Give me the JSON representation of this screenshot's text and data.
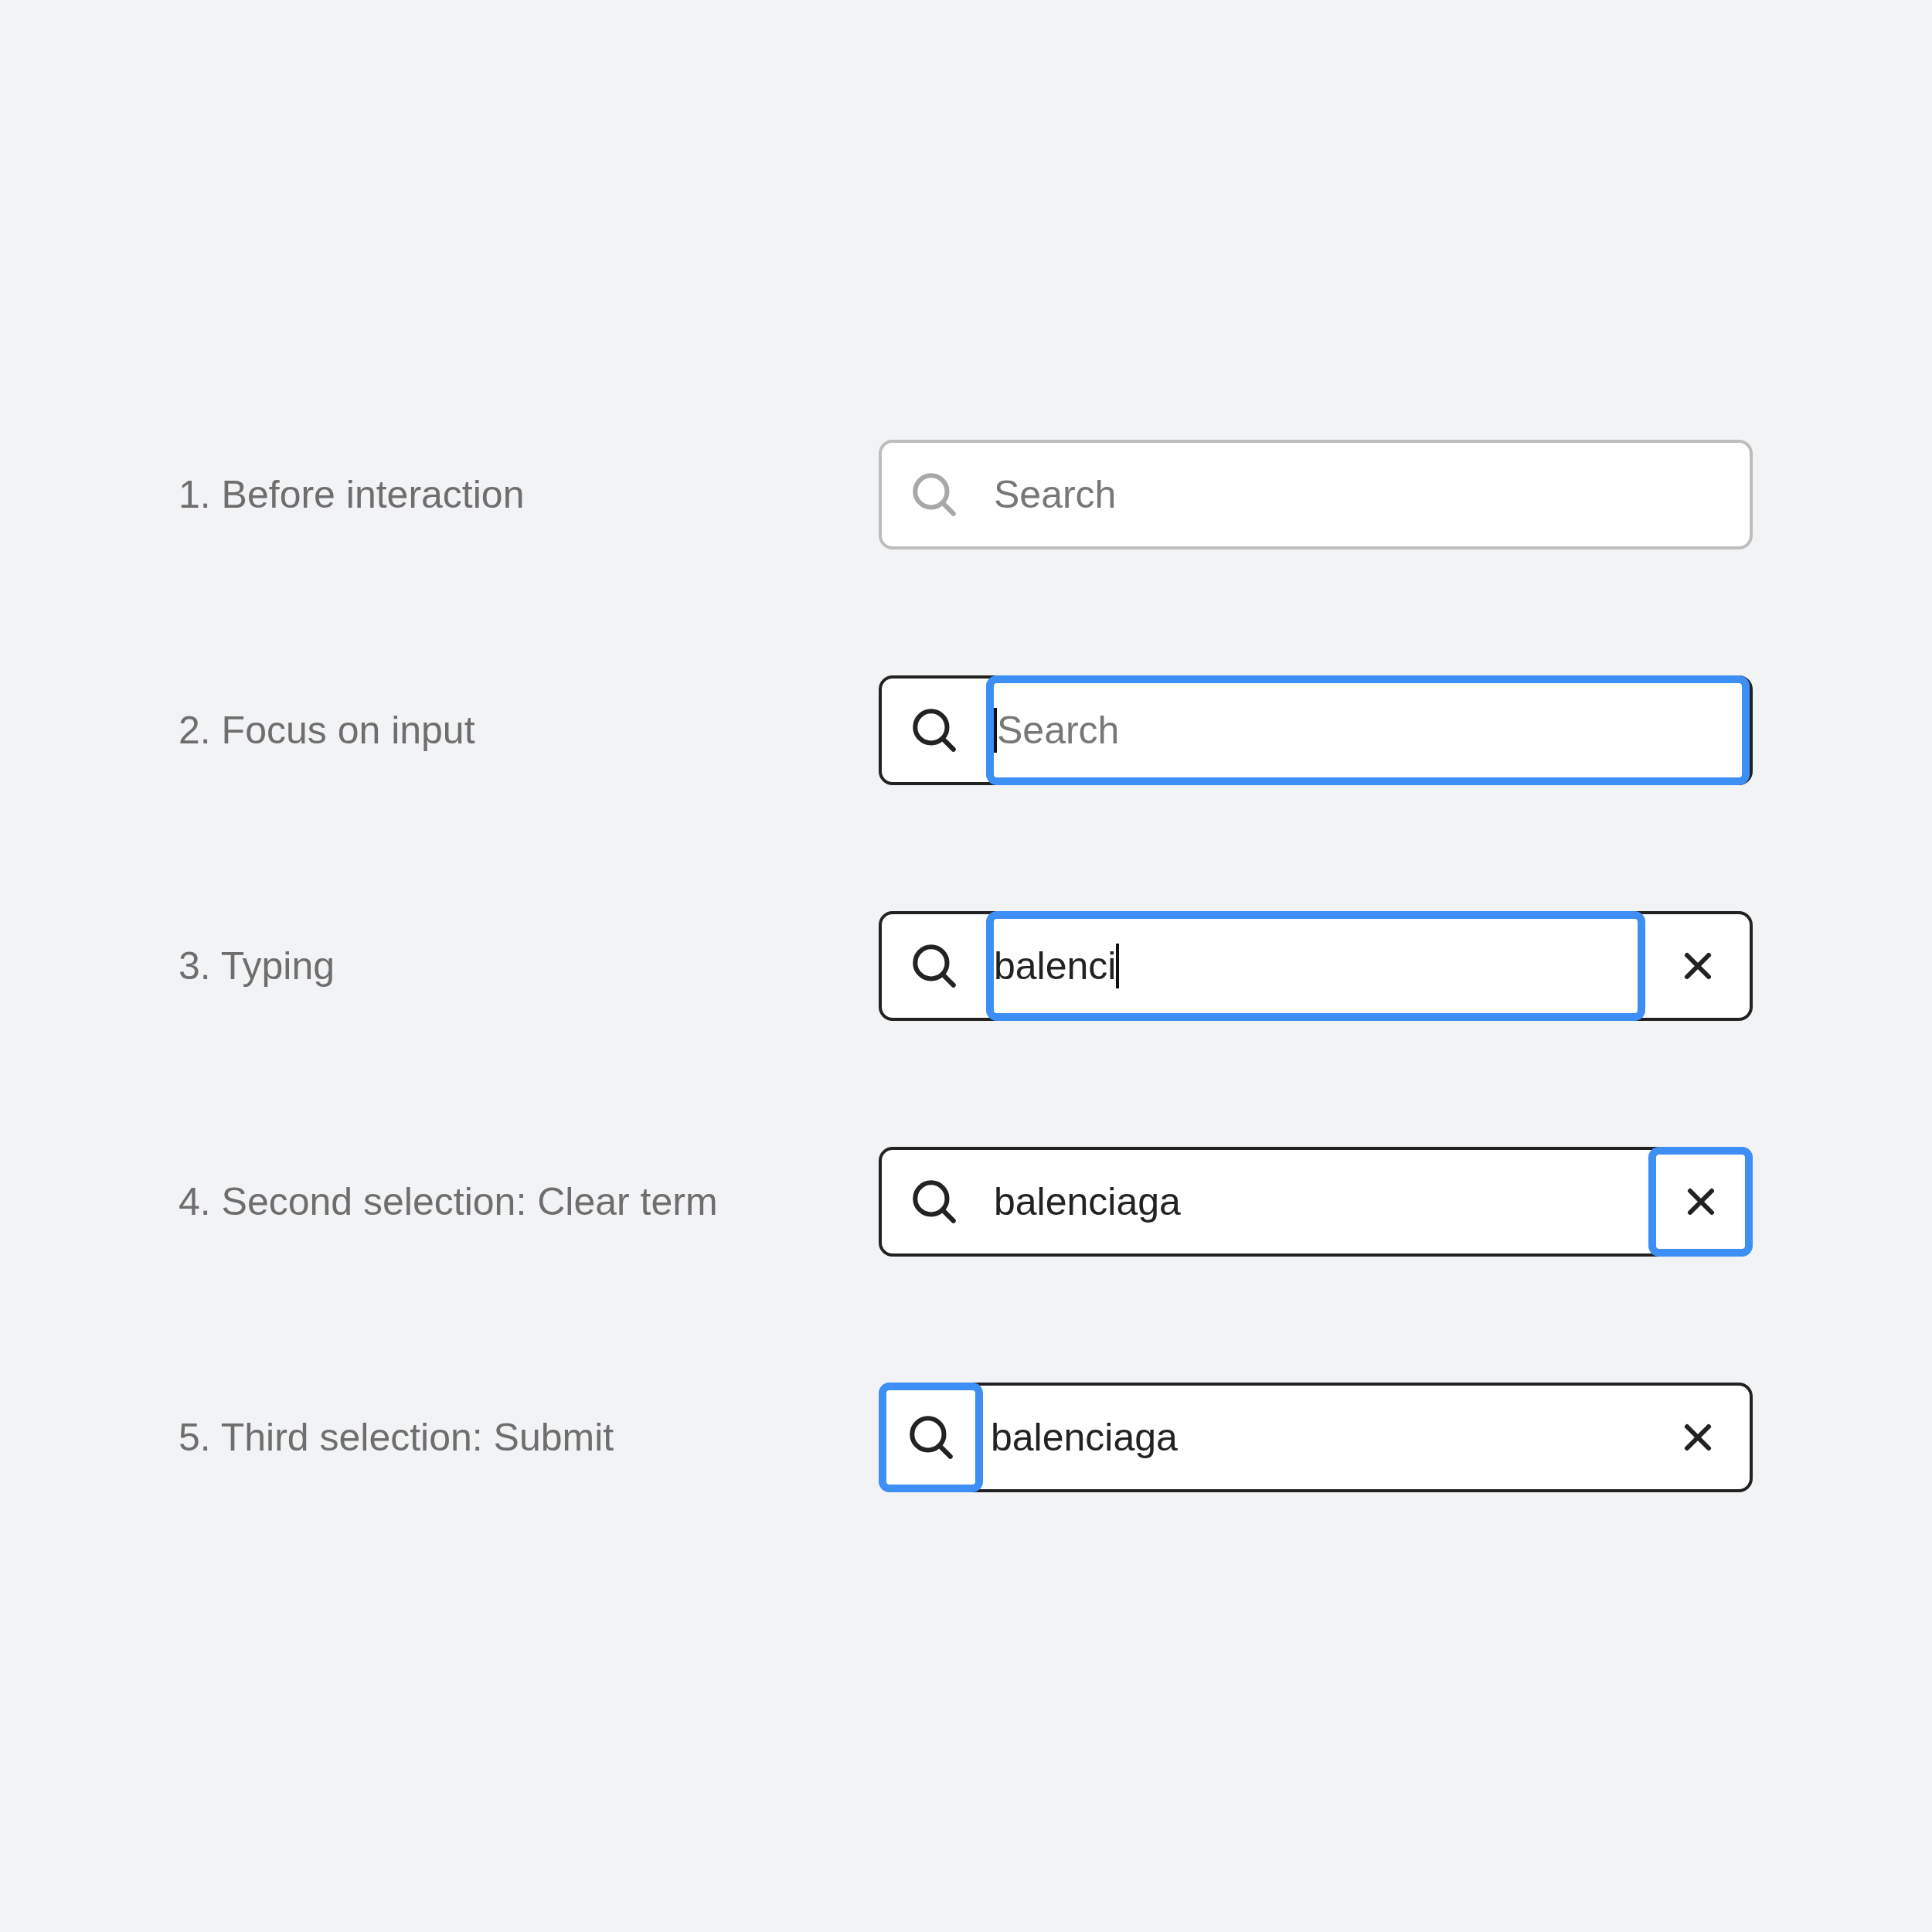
{
  "rows": [
    {
      "label": "1. Before interaction",
      "field": {
        "placeholder": "Search",
        "active": false,
        "submit_focused": false,
        "input_focused": false,
        "caret": false,
        "clear_button": false
      }
    },
    {
      "label": "2. Focus on input",
      "field": {
        "placeholder": "Search",
        "active": true,
        "submit_focused": false,
        "input_focused": true,
        "caret": true,
        "clear_button": false
      }
    },
    {
      "label": "3. Typing",
      "field": {
        "value": "balenci",
        "active": true,
        "submit_focused": false,
        "input_focused": true,
        "clear_focused": false,
        "caret": true,
        "clear_button": true
      }
    },
    {
      "label": "4. Second selection: Clear term",
      "field": {
        "value": "balenciaga",
        "active": true,
        "submit_focused": false,
        "input_focused": false,
        "clear_focused": true,
        "caret": false,
        "clear_button": true
      }
    },
    {
      "label": "5. Third selection: Submit",
      "field": {
        "value": "balenciaga",
        "active": true,
        "submit_focused": true,
        "input_focused": false,
        "clear_focused": false,
        "caret": false,
        "clear_button": true
      }
    }
  ]
}
